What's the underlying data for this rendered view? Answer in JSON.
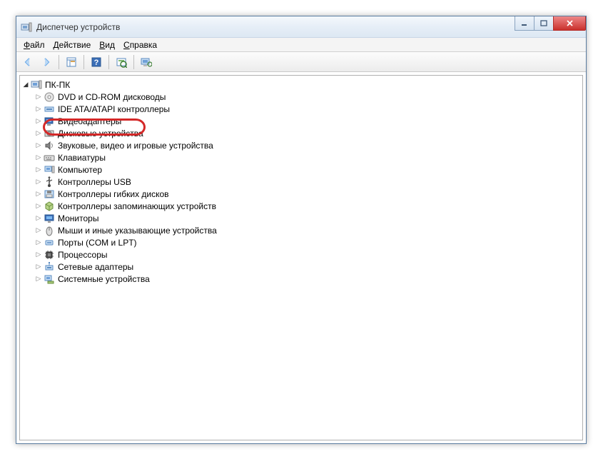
{
  "window": {
    "title": "Диспетчер устройств"
  },
  "menu": {
    "items": [
      {
        "label": "Файл",
        "hotkey": "Ф"
      },
      {
        "label": "Действие",
        "hotkey": "Д"
      },
      {
        "label": "Вид",
        "hotkey": "В"
      },
      {
        "label": "Справка",
        "hotkey": "С"
      }
    ]
  },
  "toolbar": {
    "buttons": [
      {
        "name": "back-button",
        "icon": "arrow-left-icon"
      },
      {
        "name": "forward-button",
        "icon": "arrow-right-icon"
      },
      {
        "name": "view-button",
        "icon": "panel-icon",
        "sep_before": true
      },
      {
        "name": "help-button",
        "icon": "help-icon",
        "sep_before": true
      },
      {
        "name": "scan-hardware-button",
        "icon": "scan-icon",
        "sep_before": true
      },
      {
        "name": "properties-button",
        "icon": "monitor-icon",
        "sep_before": true
      }
    ]
  },
  "tree": {
    "root": {
      "label": "ПК-ПК",
      "icon": "computer-icon",
      "expanded": true
    },
    "children": [
      {
        "label": "DVD и CD-ROM дисководы",
        "icon": "disc-icon"
      },
      {
        "label": "IDE ATA/ATAPI контроллеры",
        "icon": "ide-icon"
      },
      {
        "label": "Видеоадаптеры",
        "icon": "display-adapter-icon",
        "highlighted": true
      },
      {
        "label": "Дисковые устройства",
        "icon": "disk-icon"
      },
      {
        "label": "Звуковые, видео и игровые устройства",
        "icon": "sound-icon"
      },
      {
        "label": "Клавиатуры",
        "icon": "keyboard-icon"
      },
      {
        "label": "Компьютер",
        "icon": "computer-small-icon"
      },
      {
        "label": "Контроллеры USB",
        "icon": "usb-icon"
      },
      {
        "label": "Контроллеры гибких дисков",
        "icon": "floppy-ctrl-icon"
      },
      {
        "label": "Контроллеры запоминающих устройств",
        "icon": "storage-ctrl-icon"
      },
      {
        "label": "Мониторы",
        "icon": "monitor-node-icon"
      },
      {
        "label": "Мыши и иные указывающие устройства",
        "icon": "mouse-icon"
      },
      {
        "label": "Порты (COM и LPT)",
        "icon": "port-icon"
      },
      {
        "label": "Процессоры",
        "icon": "cpu-icon"
      },
      {
        "label": "Сетевые адаптеры",
        "icon": "network-icon"
      },
      {
        "label": "Системные устройства",
        "icon": "system-icon"
      }
    ]
  }
}
